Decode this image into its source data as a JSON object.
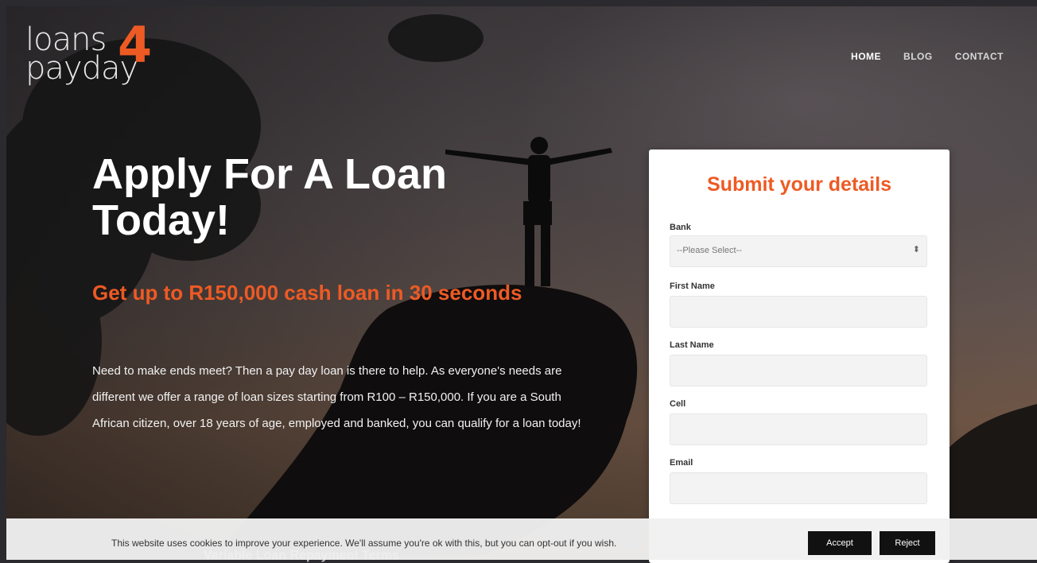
{
  "logo": {
    "line1": "loans",
    "number": "4",
    "line2": "payday"
  },
  "nav": {
    "home": "HOME",
    "blog": "BLOG",
    "contact": "CONTACT"
  },
  "hero": {
    "headline": "Apply For A Loan Today!",
    "subhead": "Get up to R150,000 cash loan in 30 seconds",
    "intro": "Need to make ends meet? Then a pay day loan is there to help. As everyone's needs are different we offer a range of loan sizes starting from R100 – R150,000. If you are a South African citizen, over 18 years of age, employed and banked, you can qualify for a loan today!"
  },
  "form": {
    "title": "Submit your details",
    "bank_label": "Bank",
    "bank_value": "--Please Select--",
    "first_name_label": "First Name",
    "last_name_label": "Last Name",
    "cell_label": "Cell",
    "email_label": "Email"
  },
  "cookie": {
    "text": "This website uses cookies to improve your experience. We'll assume you're ok with this, but you can opt-out if you wish.",
    "accept": "Accept",
    "reject": "Reject"
  },
  "below": {
    "heading": "Variable Loan Repayment Terms"
  },
  "colors": {
    "accent": "#ee5a24"
  }
}
